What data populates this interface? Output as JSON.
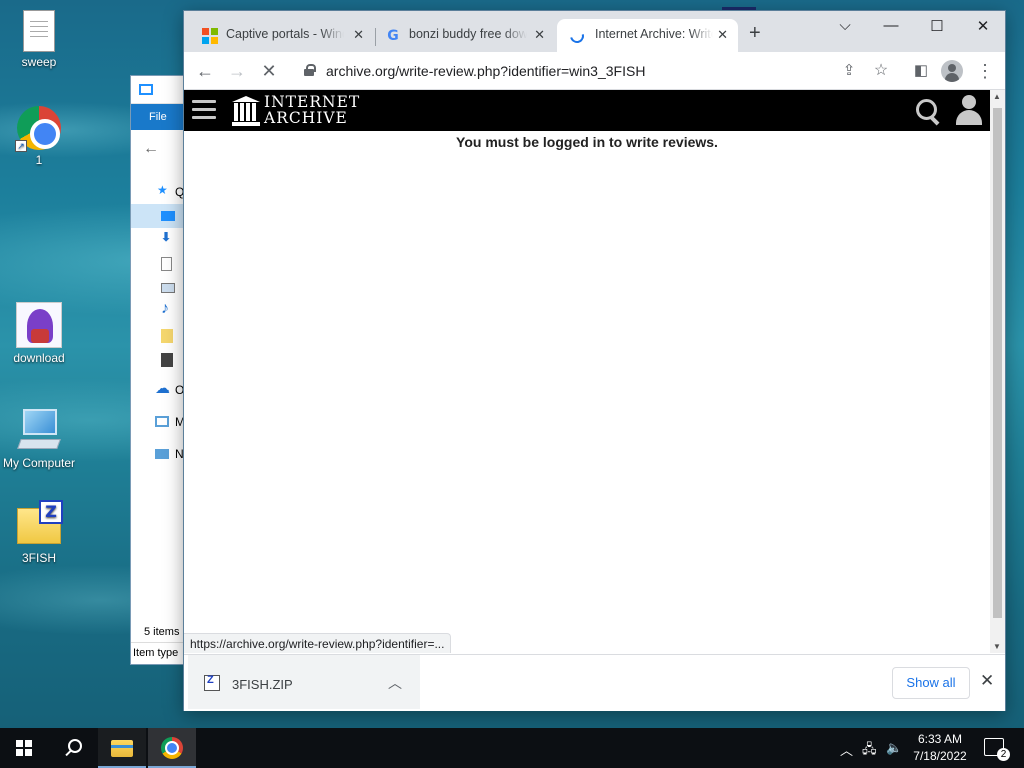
{
  "desktop": {
    "icons": [
      {
        "label": "sweep"
      },
      {
        "label": "1"
      },
      {
        "label": "download"
      },
      {
        "label": "My Computer"
      },
      {
        "label": "3FISH"
      }
    ]
  },
  "explorer": {
    "file_tab": "File",
    "tree": [
      "Q",
      "",
      "",
      "",
      "",
      "",
      "",
      "O",
      "M",
      "N"
    ],
    "status": "5 items",
    "status2": "Item type"
  },
  "browser": {
    "tabs": [
      {
        "title": "Captive portals - Wind",
        "favicon": "microsoft-icon"
      },
      {
        "title": "bonzi buddy free down",
        "favicon": "google-icon"
      },
      {
        "title": "Internet Archive: Write",
        "favicon": "loading-spinner-icon"
      }
    ],
    "new_tab": "+",
    "url": "archive.org/write-review.php?identifier=win3_3FISH",
    "status_url": "https://archive.org/write-review.php?identifier=..."
  },
  "page": {
    "logo_line1": "INTERNET",
    "logo_line2": "ARCHIVE",
    "notice": "You must be logged in to write reviews."
  },
  "downloads": {
    "file": "3FISH.ZIP",
    "show_all": "Show all"
  },
  "taskbar": {
    "time": "6:33 AM",
    "date": "7/18/2022",
    "notifications": "2"
  }
}
